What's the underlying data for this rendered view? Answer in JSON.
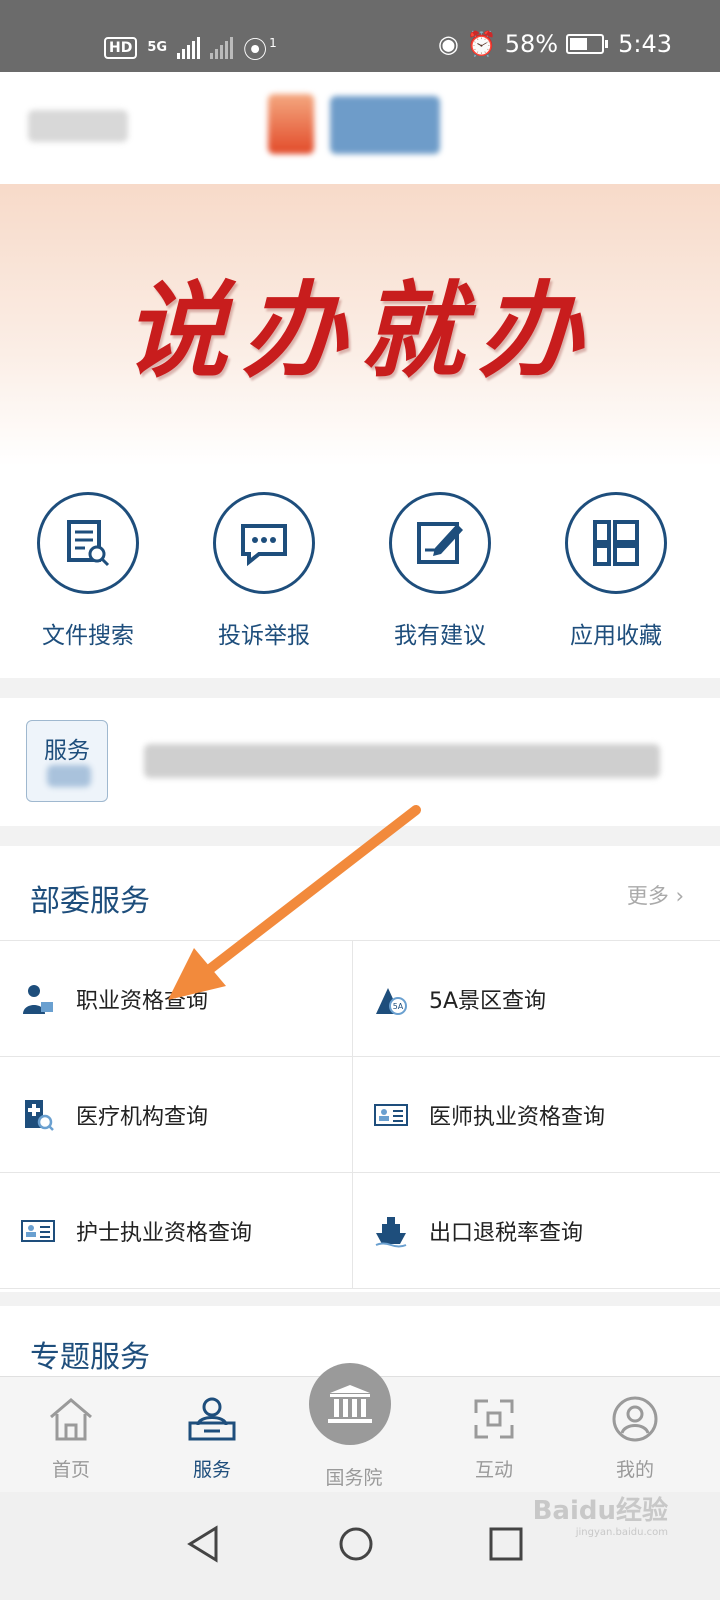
{
  "status_bar": {
    "hd": "HD",
    "network": "5G",
    "hotspot_count": "1",
    "battery": "58%",
    "battery_level": 0.58,
    "time": "5:43"
  },
  "banner": {
    "text": "说办就办"
  },
  "quick_actions": [
    {
      "label": "文件搜索",
      "icon": "document-search-icon"
    },
    {
      "label": "投诉举报",
      "icon": "chat-bubble-icon"
    },
    {
      "label": "我有建议",
      "icon": "edit-note-icon"
    },
    {
      "label": "应用收藏",
      "icon": "app-grid-icon"
    }
  ],
  "notice": {
    "badge": "服务"
  },
  "ministry_services": {
    "title": "部委服务",
    "more": "更多",
    "items": [
      {
        "label": "职业资格查询",
        "icon": "certified-person-icon"
      },
      {
        "label": "5A景区查询",
        "icon": "scenic-mountain-icon"
      },
      {
        "label": "医疗机构查询",
        "icon": "hospital-search-icon"
      },
      {
        "label": "医师执业资格查询",
        "icon": "id-card-icon"
      },
      {
        "label": "护士执业资格查询",
        "icon": "id-card-icon"
      },
      {
        "label": "出口退税率查询",
        "icon": "ship-icon"
      }
    ]
  },
  "special_services": {
    "title": "专题服务"
  },
  "tab_bar": {
    "tabs": [
      {
        "label": "首页",
        "icon": "home-icon"
      },
      {
        "label": "服务",
        "icon": "service-person-icon"
      },
      {
        "label": "国务院",
        "icon": "state-council-icon"
      },
      {
        "label": "互动",
        "icon": "interact-icon"
      },
      {
        "label": "我的",
        "icon": "profile-icon"
      }
    ],
    "active": "服务"
  },
  "watermark": {
    "brand": "Baidu经验",
    "url": "jingyan.baidu.com"
  },
  "colors": {
    "primary": "#1e4e7c",
    "banner_red": "#c81d1d",
    "arrow": "#f28a3c"
  }
}
